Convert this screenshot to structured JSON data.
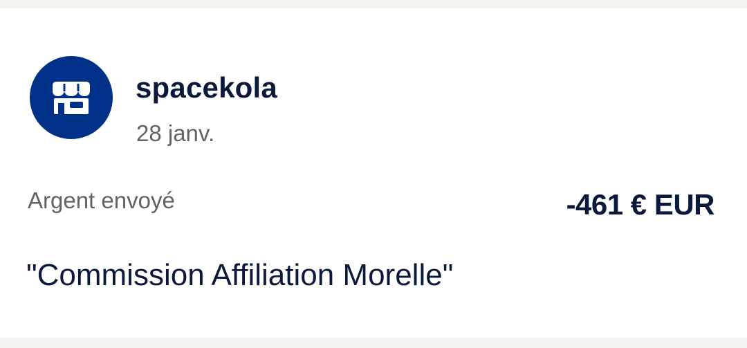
{
  "transaction": {
    "merchant_name": "spacekola",
    "date": "28 janv.",
    "type_label": "Argent envoyé",
    "amount": "-461 € EUR",
    "note": "\"Commission Affiliation Morelle\"",
    "icon": "store-icon",
    "avatar_color": "#003087"
  }
}
